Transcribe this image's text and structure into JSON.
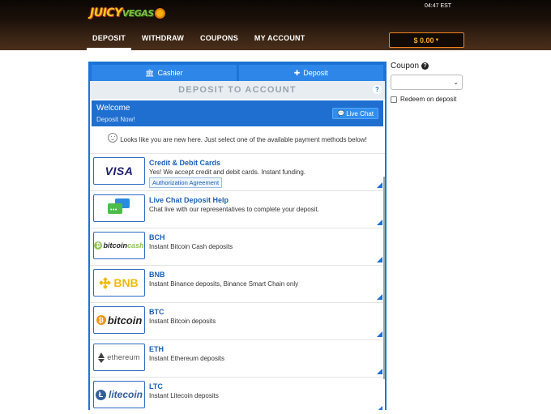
{
  "header": {
    "logo_part1": "JUICY",
    "logo_part2": "VEGAS",
    "time": "04:47 EST",
    "nav": [
      "DEPOSIT",
      "WITHDRAW",
      "COUPONS",
      "MY ACCOUNT"
    ],
    "active_nav": "DEPOSIT",
    "balance": "$ 0.00"
  },
  "panel": {
    "tabs": [
      {
        "label": "Cashier",
        "icon": "bank-icon"
      },
      {
        "label": "Deposit",
        "icon": "plus-icon"
      }
    ],
    "title": "DEPOSIT TO ACCOUNT",
    "help": "?",
    "welcome": {
      "heading": "Welcome",
      "subheading": "Deposit Now!",
      "live_chat": "Live Chat"
    },
    "new_user_message": "Looks like you are new here. Just select one of the available payment methods below!",
    "methods": [
      {
        "title": "Credit & Debit Cards",
        "description": "Yes! We accept credit and debit cards. Instant funding.",
        "badge": "Authorization Agreement",
        "logo": "VISA"
      },
      {
        "title": "Live Chat Deposit Help",
        "description": "Chat live with our representatives to complete your deposit.",
        "logo": "chat"
      },
      {
        "title": "BCH",
        "description": "Instant Bitcoin Cash deposits",
        "logo_a": "bitcoin",
        "logo_b": "cash"
      },
      {
        "title": "BNB",
        "description": "Instant Binance deposits, Binance Smart Chain only",
        "logo": "BNB"
      },
      {
        "title": "BTC",
        "description": "Instant Bitcoin deposits",
        "logo": "bitcoin"
      },
      {
        "title": "ETH",
        "description": "Instant Ethereum deposits",
        "logo": "ethereum"
      },
      {
        "title": "LTC",
        "description": "Instant Litecoin deposits",
        "logo": "litecoin"
      }
    ]
  },
  "sidebar": {
    "coupon_label": "Coupon",
    "coupon_value": "",
    "redeem_label": "Redeem on deposit",
    "redeem_checked": false
  },
  "colors": {
    "primary_blue": "#1e73d6",
    "balance_orange": "#f0821e"
  }
}
